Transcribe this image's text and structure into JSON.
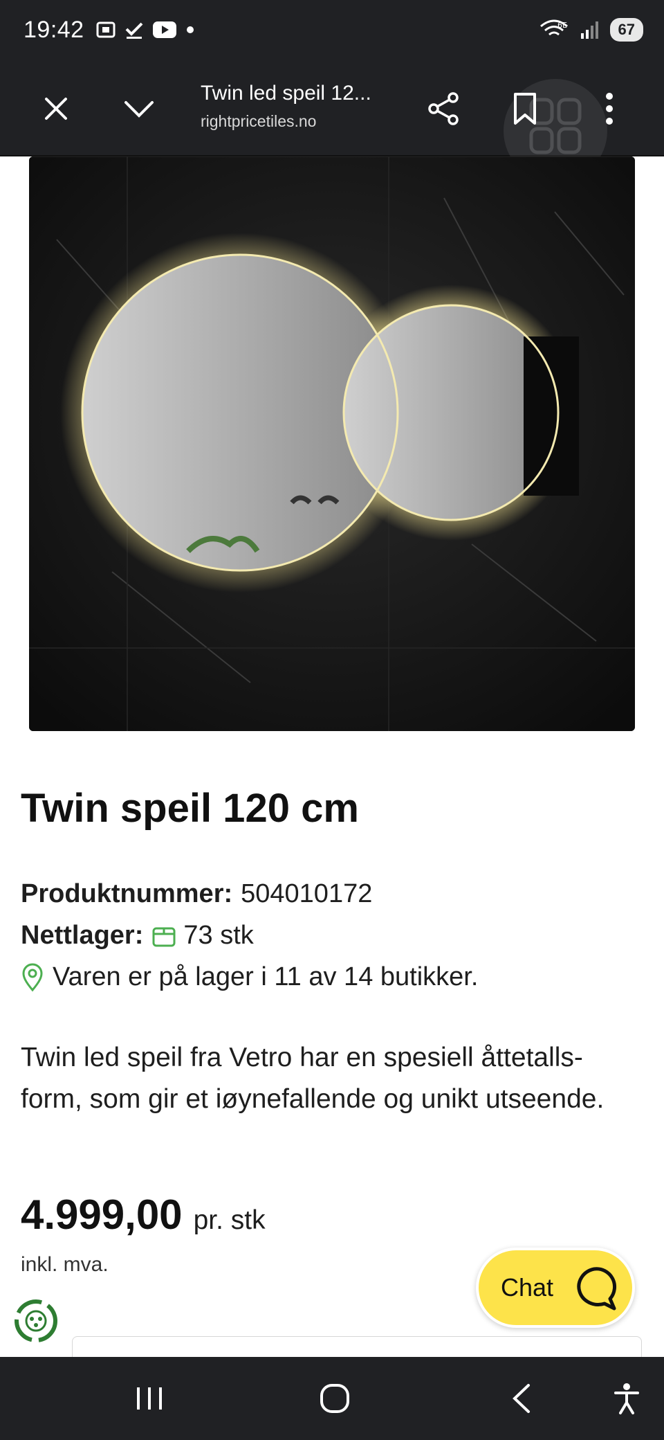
{
  "status_bar": {
    "time": "19:42",
    "network": "6E",
    "battery": "67"
  },
  "browser": {
    "page_title": "Twin led speil 12...",
    "domain": "rightpricetiles.no"
  },
  "product": {
    "title": "Twin speil 120 cm",
    "product_number_label": "Produktnummer:",
    "product_number": "504010172",
    "stock_label": "Nettlager:",
    "stock_value": "73 stk",
    "store_availability": "Varen er på lager i 11 av 14 butikker.",
    "description": "Twin led speil fra Vetro har en spesiell åttetalls-form, som gir et iøynefallende og unikt utseende.",
    "price": "4.999,00",
    "price_unit": "pr. stk",
    "vat_note": "inkl. mva."
  },
  "chat": {
    "label": "Chat"
  },
  "colors": {
    "toolbar_bg": "#202124",
    "chat_yellow": "#fde34a",
    "stock_green": "#4caf50",
    "recycle_green": "#2e7d32"
  },
  "icons": [
    "close-icon",
    "chevron-down-icon",
    "share-icon",
    "bookmark-icon",
    "more-vert-icon",
    "package-icon",
    "location-pin-icon",
    "chat-bubble-icon",
    "recycle-icon",
    "recents-icon",
    "home-icon",
    "back-icon",
    "accessibility-icon"
  ]
}
